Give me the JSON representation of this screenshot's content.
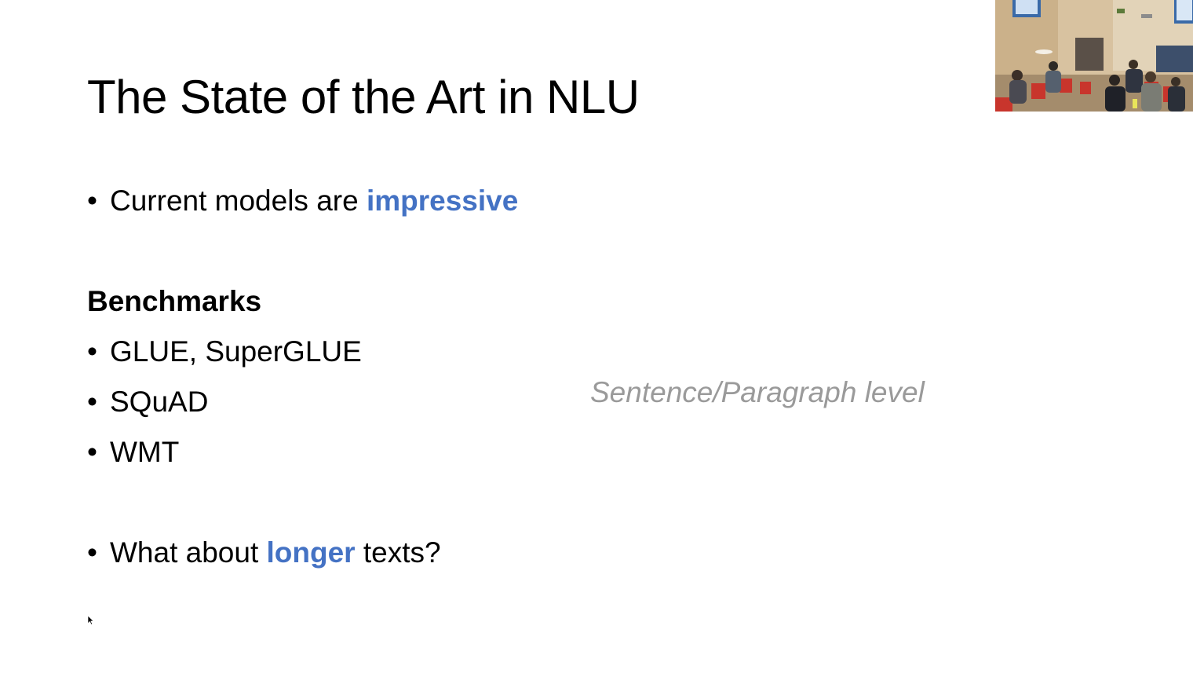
{
  "slide": {
    "title": "The State of the Art in NLU",
    "bullet_glyph": "•",
    "intro": {
      "prefix": "Current models are ",
      "emphasis": "impressive"
    },
    "benchmarks_heading": "Benchmarks",
    "benchmarks": [
      "GLUE, SuperGLUE",
      "SQuAD",
      "WMT"
    ],
    "aside_note": "Sentence/Paragraph level",
    "question": {
      "prefix": "What about ",
      "emphasis": "longer",
      "suffix": " texts?"
    },
    "accent_color": "#4472c4",
    "aside_color": "#9a9a9a"
  },
  "video_inset": {
    "description_icon": "speaker-camera-feed"
  },
  "cursor_icon": "mouse-pointer-icon"
}
